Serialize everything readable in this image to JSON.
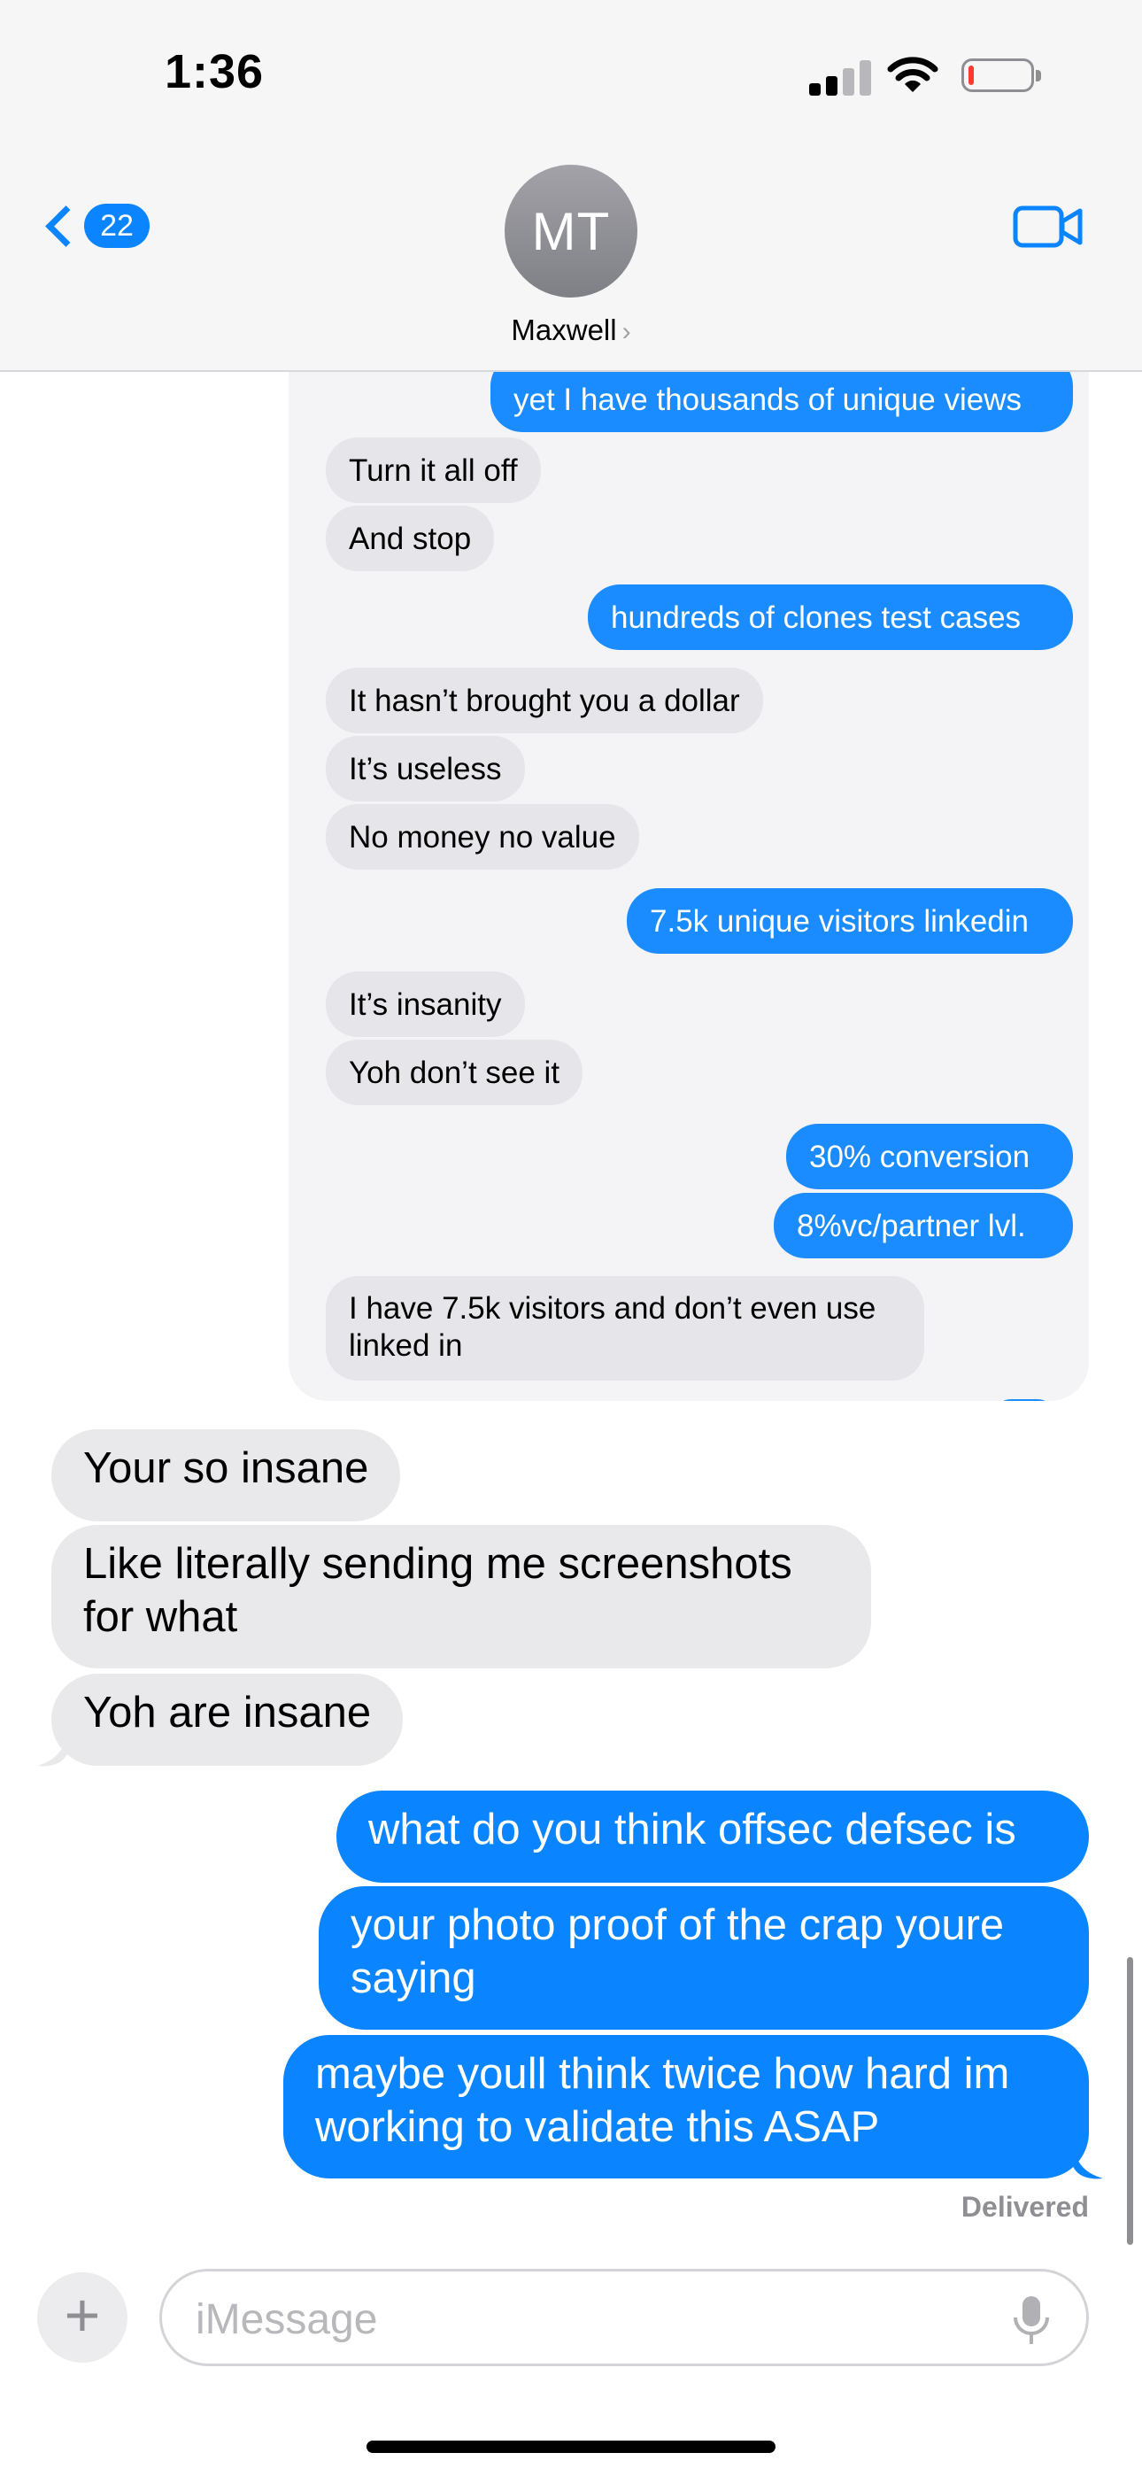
{
  "status_bar": {
    "time": "1:36",
    "battery_level_percent": 5
  },
  "header": {
    "back_count": "22",
    "avatar_initials": "MT",
    "contact_name": "Maxwell",
    "chevron": "›"
  },
  "embedded_screenshot": {
    "messages": [
      {
        "side": "out",
        "text": "yet I have thousands of unique views"
      },
      {
        "side": "in",
        "text": "Turn it all off"
      },
      {
        "side": "in",
        "text": "And stop"
      },
      {
        "side": "out",
        "text": "hundreds of clones test cases"
      },
      {
        "side": "in",
        "text": "It hasn’t brought you a dollar"
      },
      {
        "side": "in",
        "text": "It’s useless"
      },
      {
        "side": "in",
        "text": "No money no value"
      },
      {
        "side": "out",
        "text": "7.5k unique visitors linkedin"
      },
      {
        "side": "in",
        "text": "It’s insanity"
      },
      {
        "side": "in",
        "text": "Yoh don’t see it"
      },
      {
        "side": "out",
        "text": "30% conversion"
      },
      {
        "side": "out",
        "text": "8%vc/partner lvl."
      },
      {
        "side": "in",
        "text": "I have 7.5k visitors and don’t even use linked in"
      }
    ]
  },
  "messages": [
    {
      "side": "in",
      "text": "Your so insane"
    },
    {
      "side": "in",
      "text": "Like literally sending me screenshots for what"
    },
    {
      "side": "in",
      "text": "Yoh are insane"
    },
    {
      "side": "out",
      "text": "what do you think offsec defsec is"
    },
    {
      "side": "out",
      "text": "your photo proof of the crap youre saying"
    },
    {
      "side": "out",
      "text": "maybe youll think twice how hard im working to validate this ASAP"
    }
  ],
  "delivered_label": "Delivered",
  "input": {
    "placeholder": "iMessage",
    "value": ""
  },
  "icons": {
    "back": "chevron-left-icon",
    "video": "video-camera-icon",
    "plus": "plus-icon",
    "mic": "microphone-icon"
  },
  "colors": {
    "accent": "#0a84ff",
    "incoming": "#e9e9eb",
    "outgoing": "#0a84ff"
  }
}
